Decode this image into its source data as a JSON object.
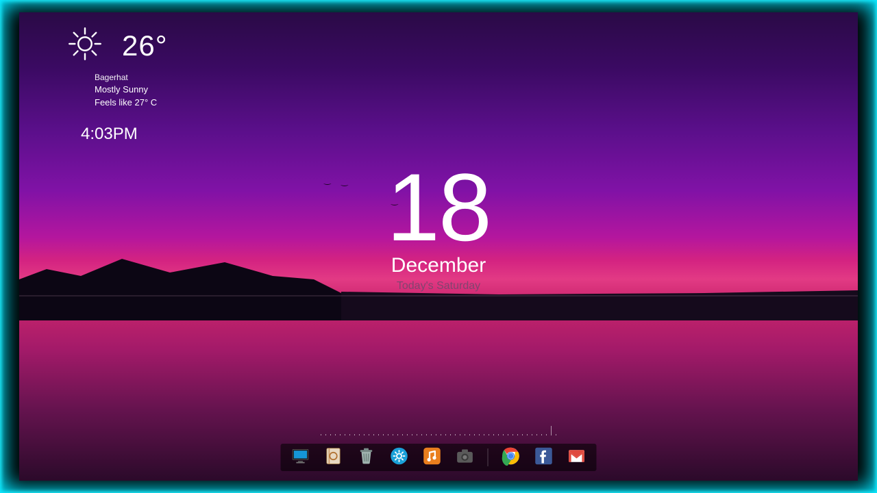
{
  "weather": {
    "temperature": "26°",
    "location": "Bagerhat",
    "condition": "Mostly Sunny",
    "feels_like": "Feels like 27° C",
    "icon": "sun-icon"
  },
  "clock": {
    "time": "4:03PM"
  },
  "date": {
    "day_number": "18",
    "month": "December",
    "today_label": "Today's Saturday"
  },
  "dock": {
    "items": [
      {
        "name": "computer-icon",
        "label": "This PC",
        "color": "#2aa7e0"
      },
      {
        "name": "notebook-icon",
        "label": "Notes",
        "color": "#d89a4a"
      },
      {
        "name": "trash-icon",
        "label": "Recycle",
        "color": "#8fa3a0"
      },
      {
        "name": "settings-icon",
        "label": "Settings",
        "color": "#2aa7e0"
      },
      {
        "name": "music-icon",
        "label": "Music",
        "color": "#e98020"
      },
      {
        "name": "camera-icon",
        "label": "Camera",
        "color": "#6b6b6b"
      }
    ],
    "pinned": [
      {
        "name": "chrome-icon",
        "label": "Chrome"
      },
      {
        "name": "facebook-icon",
        "label": "Facebook"
      },
      {
        "name": "gmail-icon",
        "label": "Gmail"
      }
    ]
  },
  "colors": {
    "glow": "#00e5ff",
    "text": "#ffffff"
  }
}
